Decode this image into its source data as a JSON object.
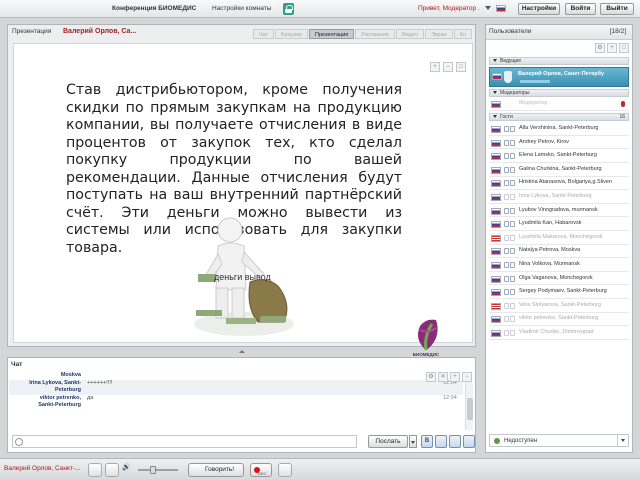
{
  "topbar": {
    "conference": "Конференция БИОМЕДИС",
    "room_settings": "Настройки комнаты",
    "greeting": "Привет, Модератор .",
    "settings_button": "Настройки",
    "login_button": "Войти",
    "logout_button": "Выйти"
  },
  "presentation": {
    "title": "Презентация",
    "presenter": "Валерий Орлов, Са...",
    "tabs": [
      "Чат",
      "Браузер",
      "Презентация",
      "Рисование",
      "Видео",
      "Экран",
      "Кл"
    ],
    "active_tab": "Презентация",
    "slide_text": "Став дистрибьютором, кроме получения скидки по прямым закупкам на продукцию компании, вы получаете отчисления в виде процентов от закупок тех, кто сделал покупку продукции по вашей рекомендации. Данные отчисления будут поступать на ваш внутренний партнёрский счёт. Эти деньги можно вывести из системы или использовать для закупки товара.",
    "image_caption": "деньги вывод",
    "logo_text": "БИОМЕДИС"
  },
  "chat": {
    "title": "Чат",
    "messages": [
      {
        "who": "Moskva",
        "text": "",
        "time": ""
      },
      {
        "who": "Irina Lykova, Sankt-",
        "text": "++++++!!!!",
        "time": "12:04"
      },
      {
        "who": "Peterburg",
        "text": "",
        "time": ""
      },
      {
        "who": "viktor petrenko,",
        "text": "да",
        "time": "12:04"
      },
      {
        "who": "Sankt-Peterburg",
        "text": "",
        "time": ""
      }
    ],
    "input_value": "",
    "send_button": "Послать",
    "format_bold": "B"
  },
  "users": {
    "title": "Пользователи",
    "count": "[18/2]",
    "sections": {
      "leaders": "Ведущие",
      "moderators": "Модераторы",
      "guests": "Гости",
      "guests_count": "16"
    },
    "leader": "Валерий Орлов, Санкт-Петербу",
    "moderator": "Модератор .",
    "guests": [
      {
        "name": "Alla Vershinina, Sankt-Peterburg",
        "flag": "ru",
        "offline": false
      },
      {
        "name": "Andrey Petrov, Kirov",
        "flag": "ru",
        "offline": false
      },
      {
        "name": "Elena Lamsko, Sankt-Peterburg",
        "flag": "ru",
        "offline": false
      },
      {
        "name": "Galina Churkina, Sankt-Peterburg",
        "flag": "ru",
        "offline": false
      },
      {
        "name": "Hristina Atanasova, Bolgariya,g.Sliven",
        "flag": "bg",
        "offline": false
      },
      {
        "name": "Irina Lykova, Sankt-Peterburg",
        "flag": "ru",
        "offline": true
      },
      {
        "name": "Lyubov Vinogradova, murmansk",
        "flag": "ru",
        "offline": false
      },
      {
        "name": "Lyudmila Kan, Habarovsk",
        "flag": "ru",
        "offline": false
      },
      {
        "name": "Lyudmila Makarova, Monchegorsk",
        "flag": "us",
        "offline": true
      },
      {
        "name": "Natalya Petrova, Moskva",
        "flag": "ru",
        "offline": false
      },
      {
        "name": "Nina Volkova, Murmansk",
        "flag": "ru",
        "offline": false
      },
      {
        "name": "Olga Vaganova, Monchegorsk",
        "flag": "ru",
        "offline": false
      },
      {
        "name": "Sergey Podymaev, Sankt-Peterburg",
        "flag": "ru",
        "offline": false
      },
      {
        "name": "Vera Stolyarova, Sankt-Peterburg",
        "flag": "us",
        "offline": true
      },
      {
        "name": "viktor petrenko, Sankt-Peterburg",
        "flag": "ru",
        "offline": true
      },
      {
        "name": "Vladimir Churkin, Dimitrovgrad",
        "flag": "ru",
        "offline": true
      }
    ],
    "status": "Недоступен"
  },
  "bottombar": {
    "me": "Валерий Орлов, Санкт-...",
    "talk_button": "Говорить!",
    "rec_label": "REC"
  },
  "colors": {
    "accent_red": "#b01818",
    "leader_blue": "#3d8fb2",
    "active_tab": "#c8ccd0"
  }
}
